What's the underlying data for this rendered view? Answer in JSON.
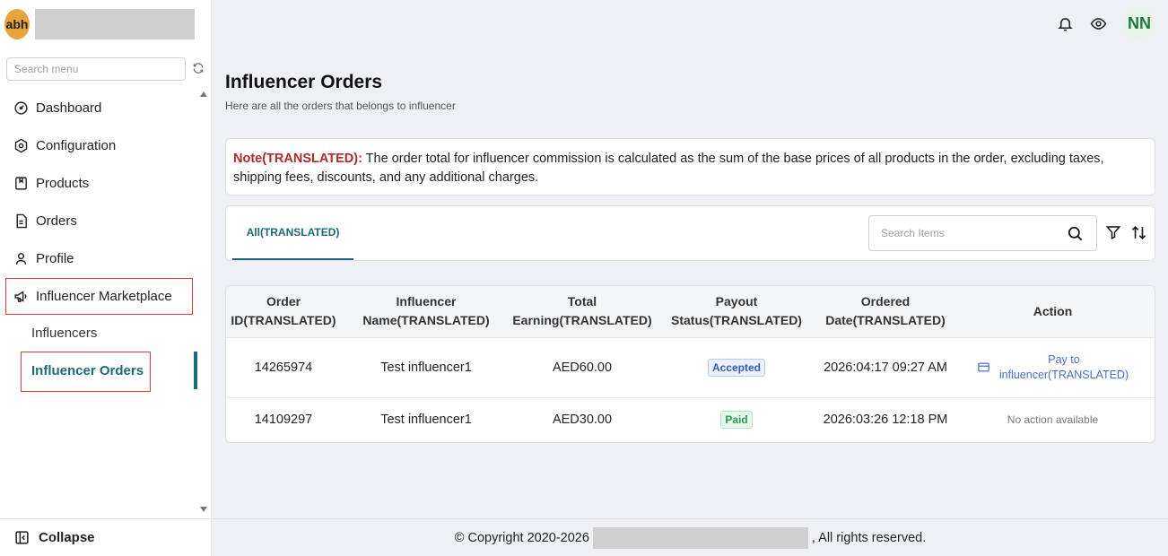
{
  "brand": {
    "logo_text": "abh"
  },
  "sidebar": {
    "search_placeholder": "Search menu",
    "items": [
      {
        "label": "Dashboard",
        "icon": "dashboard-icon"
      },
      {
        "label": "Configuration",
        "icon": "gear-icon"
      },
      {
        "label": "Products",
        "icon": "bookmark-icon"
      },
      {
        "label": "Orders",
        "icon": "document-icon"
      },
      {
        "label": "Profile",
        "icon": "user-icon"
      },
      {
        "label": "Influencer Marketplace",
        "icon": "megaphone-icon"
      }
    ],
    "sub_items": [
      {
        "label": "Influencers"
      },
      {
        "label": "Influencer Orders",
        "active": true
      }
    ],
    "collapse_label": "Collapse"
  },
  "topbar": {
    "user_initials": "NN"
  },
  "page": {
    "title": "Influencer Orders",
    "subtitle": "Here are all the orders that belongs to influencer"
  },
  "note": {
    "label": "Note(TRANSLATED):",
    "text": " The order total for influencer commission is calculated as the sum of the base prices of all products in the order, excluding taxes, shipping fees, discounts, and any additional charges."
  },
  "tabs": {
    "all_label": "All(TRANSLATED)"
  },
  "search": {
    "placeholder": "Search Items"
  },
  "table": {
    "headers": [
      [
        "Order",
        "ID(TRANSLATED)"
      ],
      [
        "Influencer",
        "Name(TRANSLATED)"
      ],
      [
        "Total",
        "Earning(TRANSLATED)"
      ],
      [
        "Payout",
        "Status(TRANSLATED)"
      ],
      [
        "Ordered",
        "Date(TRANSLATED)"
      ],
      [
        "Action",
        ""
      ]
    ],
    "rows": [
      {
        "order_id": "14265974",
        "influencer": "Test influencer1",
        "earning": "AED60.00",
        "status": "Accepted",
        "date": "2026:04:17 09:27 AM",
        "action_line1": "Pay to",
        "action_line2": "influencer(TRANSLATED)"
      },
      {
        "order_id": "14109297",
        "influencer": "Test influencer1",
        "earning": "AED30.00",
        "status": "Paid",
        "date": "2026:03:26 12:18 PM",
        "action": "No action available"
      }
    ]
  },
  "footer": {
    "prefix": "© Copyright 2020-2026",
    "suffix": ", All rights reserved."
  },
  "colors": {
    "accent": "#1b6b78",
    "note_label": "#b02a2a",
    "highlight": "#e03a3a",
    "link": "#4a6fd0"
  }
}
